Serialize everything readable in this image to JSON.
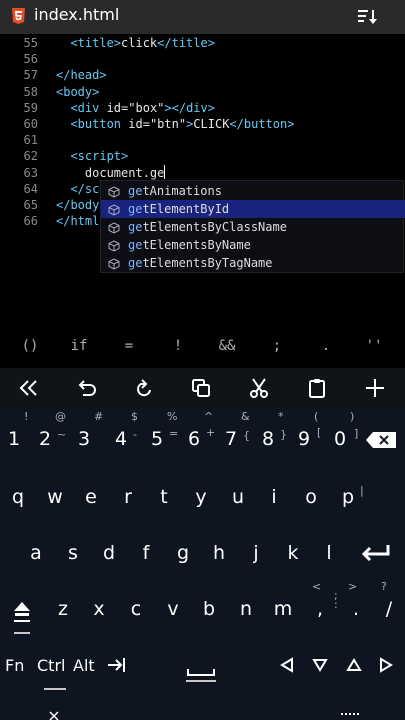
{
  "titlebar": {
    "title": "index.html",
    "file_icon": "html5-icon",
    "menu_icon": "sort-icon"
  },
  "editor": {
    "lines": [
      {
        "num": "55",
        "indent": "  ",
        "parts": [
          [
            "tag",
            "<title>"
          ],
          [
            "txt",
            "click"
          ],
          [
            "tag",
            "</title>"
          ]
        ]
      },
      {
        "num": "56",
        "indent": "",
        "parts": []
      },
      {
        "num": "57",
        "indent": "",
        "parts": [
          [
            "tag",
            "</head>"
          ]
        ]
      },
      {
        "num": "58",
        "indent": "",
        "parts": [
          [
            "tag",
            "<body>"
          ]
        ]
      },
      {
        "num": "59",
        "indent": "  ",
        "parts": [
          [
            "tag",
            "<div "
          ],
          [
            "attr",
            "id="
          ],
          [
            "str",
            "\"box\""
          ],
          [
            "tag",
            "></div>"
          ]
        ]
      },
      {
        "num": "60",
        "indent": "  ",
        "parts": [
          [
            "tag",
            "<button "
          ],
          [
            "attr",
            "id="
          ],
          [
            "str",
            "\"btn\""
          ],
          [
            "tag",
            ">"
          ],
          [
            "txt",
            "CLICK"
          ],
          [
            "tag",
            "</button>"
          ]
        ]
      },
      {
        "num": "61",
        "indent": "",
        "parts": []
      },
      {
        "num": "62",
        "indent": "  ",
        "parts": [
          [
            "tag",
            "<script>"
          ]
        ]
      },
      {
        "num": "63",
        "indent": "    ",
        "parts": [
          [
            "txt",
            "document.ge"
          ]
        ]
      },
      {
        "num": "64",
        "indent": "  ",
        "parts": [
          [
            "tag",
            "</sc"
          ]
        ]
      },
      {
        "num": "65",
        "indent": "",
        "parts": [
          [
            "tag",
            "</body"
          ]
        ]
      },
      {
        "num": "66",
        "indent": "",
        "parts": [
          [
            "tag",
            "</html"
          ]
        ]
      }
    ]
  },
  "autocomplete": {
    "typed": "ge",
    "selected_index": 1,
    "items": [
      {
        "match": "ge",
        "rest": "tAnimations"
      },
      {
        "match": "ge",
        "rest": "tElementById"
      },
      {
        "match": "ge",
        "rest": "tElementsByClassName"
      },
      {
        "match": "ge",
        "rest": "tElementsByName"
      },
      {
        "match": "ge",
        "rest": "tElementsByTagName"
      }
    ]
  },
  "symbol_bar": [
    "()",
    "if",
    "=",
    "!",
    "&&",
    ";",
    ".",
    "''"
  ],
  "toolbar": {
    "buttons": [
      "collapse-left-icon",
      "undo-icon",
      "redo-icon",
      "copy-icon",
      "cut-icon",
      "paste-icon",
      "add-icon"
    ]
  },
  "keyboard": {
    "row1": [
      {
        "main": "1",
        "sub": "!"
      },
      {
        "main": "2",
        "sub": "@"
      },
      {
        "main": "3",
        "sub": "#"
      },
      {
        "main": "4",
        "sub": "$"
      },
      {
        "main": "5",
        "sub": "%"
      },
      {
        "main": "6",
        "sub": "^"
      },
      {
        "main": "7",
        "sub": "&"
      },
      {
        "main": "8",
        "sub": "*"
      },
      {
        "main": "9",
        "sub": "("
      },
      {
        "main": "0",
        "sub": ")"
      }
    ],
    "row1_minor": [
      {
        "main": "~",
        "after": "2"
      },
      {
        "main": "-",
        "after": "4"
      },
      {
        "main": "=",
        "after": "5"
      },
      {
        "main": "+",
        "after": "6"
      },
      {
        "main": "{",
        "after": "7"
      },
      {
        "main": "}",
        "after": "8"
      },
      {
        "main": "[",
        "after": "9"
      },
      {
        "main": "]",
        "after": "0"
      }
    ],
    "row2": [
      "q",
      "w",
      "e",
      "r",
      "t",
      "y",
      "u",
      "i",
      "o",
      "p"
    ],
    "row2_sub": [
      "",
      "",
      "",
      "",
      "",
      "",
      "",
      "",
      "",
      "|"
    ],
    "row3": [
      "a",
      "s",
      "d",
      "f",
      "g",
      "h",
      "j",
      "k",
      "l"
    ],
    "row4": [
      "z",
      "x",
      "c",
      "v",
      "b",
      "n",
      "m"
    ],
    "row4_extra": [
      {
        "main": ",",
        "sub": "<"
      },
      {
        "main": ".",
        "sub": ">"
      },
      {
        "main": "/",
        "sub": "?"
      }
    ],
    "row4_minor": [
      {
        "main": ";",
        "after": "m"
      },
      {
        "main": ":",
        "after": "m2"
      }
    ],
    "row5": {
      "fn": "Fn",
      "ctrl": "Ctrl",
      "alt": "Alt"
    }
  }
}
